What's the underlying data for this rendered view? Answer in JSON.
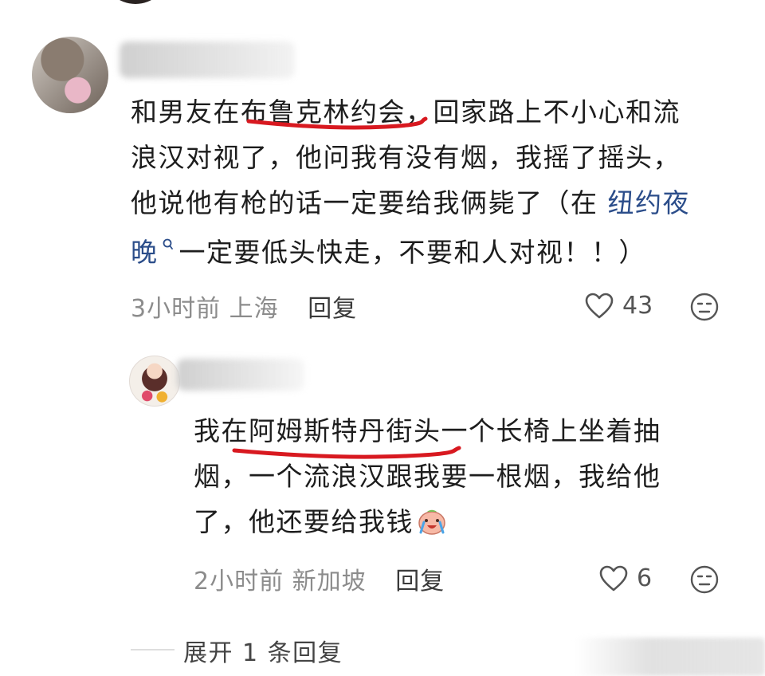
{
  "comments": [
    {
      "lines": [
        [
          "和男友在",
          "布鲁克林约会",
          "，回家路上不小心和流"
        ],
        [
          "浪汉对视了，他问我有没有烟，我摇了摇头，"
        ],
        [
          "他说他有枪的话一定要给我俩毙了（在 ",
          "纽约夜"
        ],
        [
          "晚",
          "一定要低头快走，不要和人对视！！）"
        ]
      ],
      "time": "3小时前",
      "location": "上海",
      "reply_label": "回复",
      "likes": "43",
      "underlined_text": "布鲁克林约会",
      "link_text": "纽约夜晚"
    },
    {
      "lines": [
        [
          "我在",
          "阿姆斯特丹街头",
          "一个长椅上坐着抽"
        ],
        [
          "烟，一个流浪汉跟我要一根烟，我给他"
        ],
        [
          "了，他还要给我钱"
        ]
      ],
      "time": "2小时前",
      "location": "新加坡",
      "reply_label": "回复",
      "likes": "6",
      "underlined_text": "阿姆斯特丹街头"
    }
  ],
  "expand_replies_label": "展开 1 条回复",
  "icons": {
    "like": "heart-outline-icon",
    "reply": "emoji-face-icon",
    "search": "search-icon",
    "emoji": "crying-laughing-emoji-icon"
  },
  "colors": {
    "link": "#2b4d8a",
    "underline": "#d81920",
    "meta": "#8c8c8c"
  }
}
